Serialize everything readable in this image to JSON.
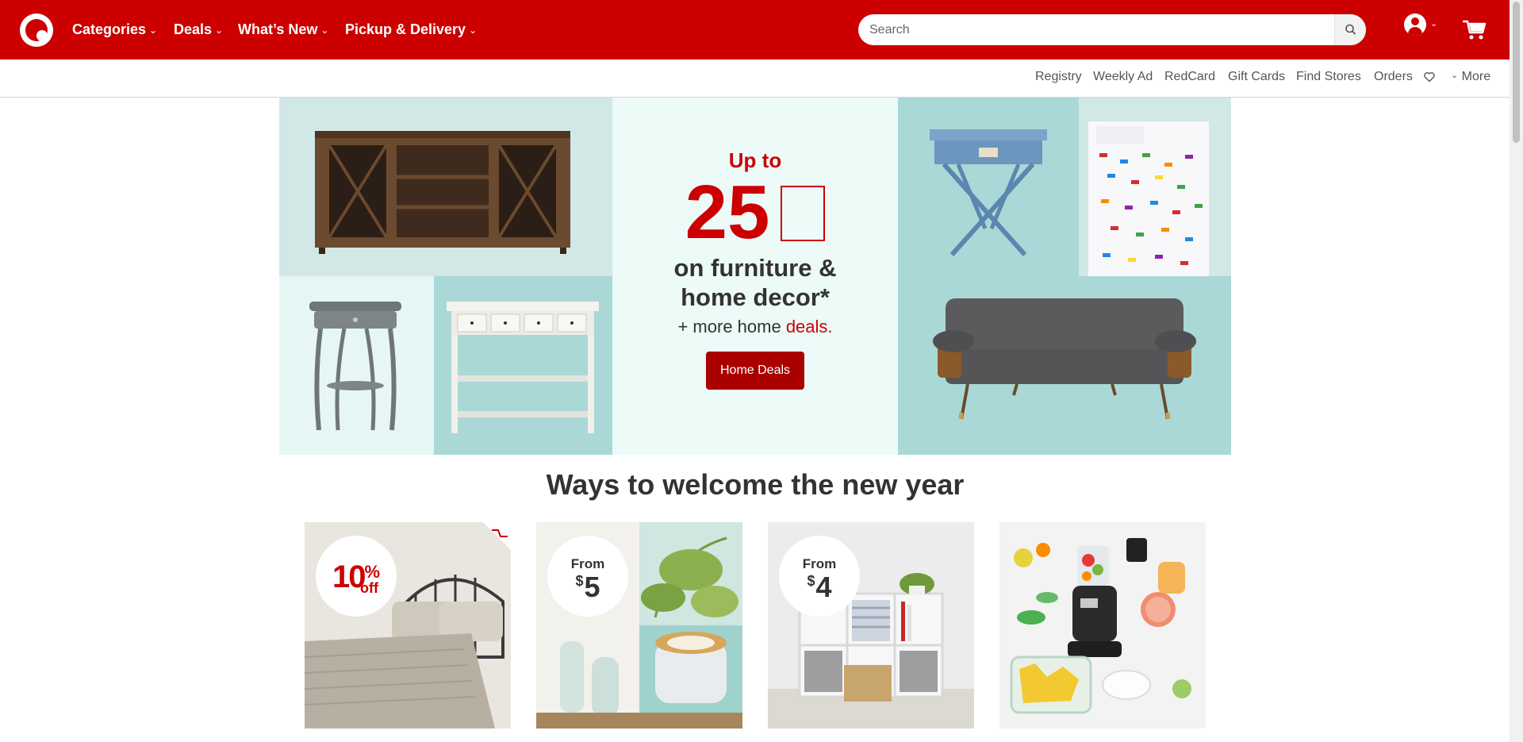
{
  "header": {
    "nav": [
      {
        "label": "Categories"
      },
      {
        "label": "Deals"
      },
      {
        "label": "What’s New"
      },
      {
        "label": "Pickup & Delivery"
      }
    ],
    "search": {
      "placeholder": "Search",
      "value": ""
    }
  },
  "utility_nav": {
    "links": [
      "Registry",
      "Weekly Ad",
      "RedCard",
      "Gift Cards",
      "Find Stores",
      "Orders"
    ],
    "more_label": "More"
  },
  "hero": {
    "up_to": "Up to",
    "percent": "25",
    "line1": "on furniture &",
    "line2": "home decor*",
    "more_prefix": "+ more home ",
    "more_red": "deals.",
    "button_label": "Home Deals"
  },
  "section": {
    "title": "Ways to welcome the new year",
    "cards": [
      {
        "badge_top": "",
        "badge_price": "10",
        "badge_suffix": "off",
        "badge_style": "percent"
      },
      {
        "badge_top": "From",
        "badge_currency": "$",
        "badge_price": "5"
      },
      {
        "badge_top": "From",
        "badge_currency": "$",
        "badge_price": "4"
      },
      {}
    ]
  },
  "colors": {
    "brand_red": "#cc0000",
    "button_red": "#aa0000",
    "hero_bg": "#ecfaf8",
    "tile_teal": "#a9d8d6",
    "tile_pale": "#d1e8e6"
  }
}
